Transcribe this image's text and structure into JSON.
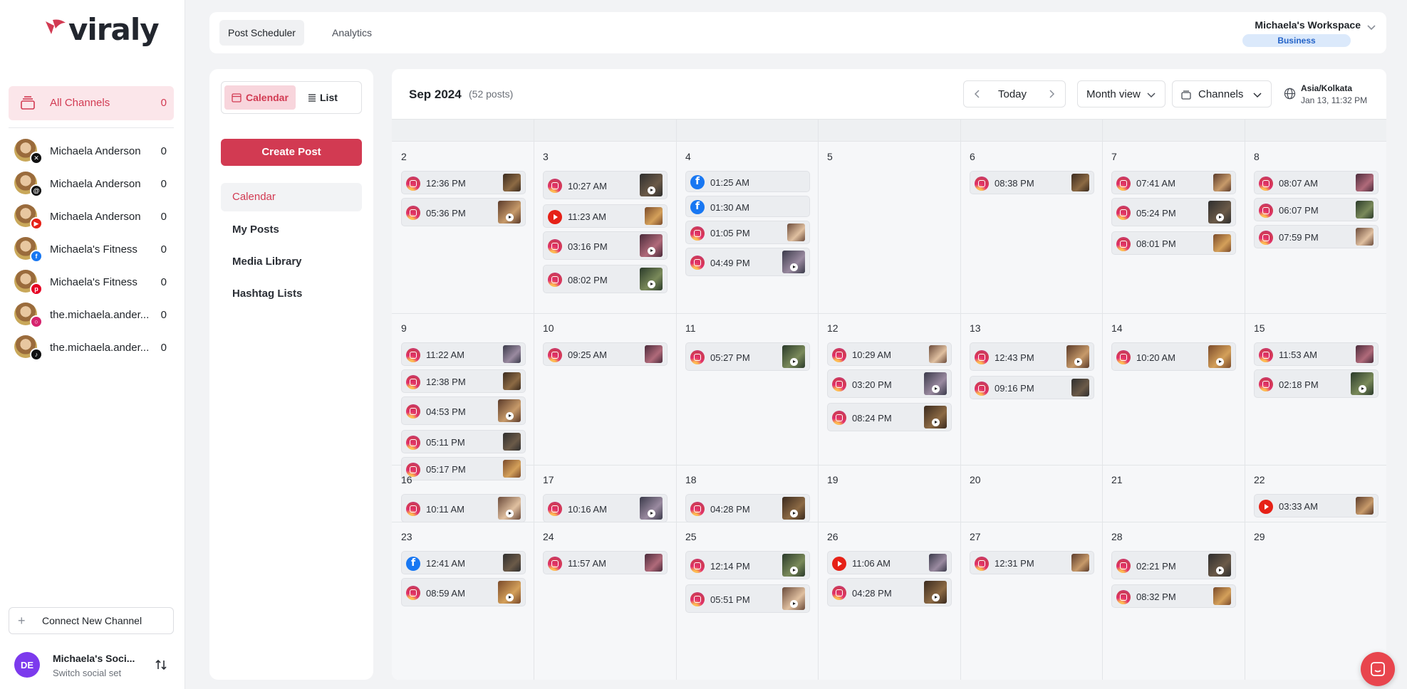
{
  "brand": {
    "name": "viraly"
  },
  "sidebar": {
    "all_channels": {
      "label": "All Channels",
      "count": "0"
    },
    "channels": [
      {
        "name": "Michaela Anderson",
        "count": "0",
        "platform": "x-icon"
      },
      {
        "name": "Michaela Anderson",
        "count": "0",
        "platform": "threads-icon"
      },
      {
        "name": "Michaela Anderson",
        "count": "0",
        "platform": "youtube-icon"
      },
      {
        "name": "Michaela's Fitness",
        "count": "0",
        "platform": "facebook-icon"
      },
      {
        "name": "Michaela's Fitness",
        "count": "0",
        "platform": "pinterest-icon"
      },
      {
        "name": "the.michaela.ander...",
        "count": "0",
        "platform": "instagram-icon"
      },
      {
        "name": "the.michaela.ander...",
        "count": "0",
        "platform": "tiktok-icon"
      }
    ],
    "connect_label": "Connect New Channel",
    "social_set": {
      "initials": "DE",
      "name": "Michaela's Soci...",
      "sub": "Switch social set"
    }
  },
  "topbar": {
    "tabs": [
      "Post Scheduler",
      "Analytics"
    ],
    "workspace": "Michaela's Workspace",
    "plan": "Business"
  },
  "nav": {
    "view_calendar": "Calendar",
    "view_list": "List",
    "create_post": "Create Post",
    "items": [
      "Calendar",
      "My Posts",
      "Media Library",
      "Hashtag Lists"
    ]
  },
  "calendar": {
    "month": "Sep 2024",
    "post_count": "(52 posts)",
    "today_label": "Today",
    "view_label": "Month view",
    "channels_label": "Channels",
    "timezone": "Asia/Kolkata",
    "now": "Jan 13, 11:32 PM",
    "weeks": [
      {
        "days": [
          {
            "num": "2",
            "posts": [
              {
                "t": "12:36 PM",
                "p": "ig",
                "v": false
              },
              {
                "t": "05:36 PM",
                "p": "ig",
                "v": true
              }
            ]
          },
          {
            "num": "3",
            "posts": [
              {
                "t": "10:27 AM",
                "p": "ig",
                "v": true
              },
              {
                "t": "11:23 AM",
                "p": "yt",
                "v": false
              },
              {
                "t": "03:16 PM",
                "p": "ig",
                "v": true
              },
              {
                "t": "08:02 PM",
                "p": "ig",
                "v": true
              }
            ]
          },
          {
            "num": "4",
            "posts": [
              {
                "t": "01:25 AM",
                "p": "fb",
                "n": true
              },
              {
                "t": "01:30 AM",
                "p": "fb",
                "n": true
              },
              {
                "t": "01:05 PM",
                "p": "ig",
                "v": false
              },
              {
                "t": "04:49 PM",
                "p": "ig",
                "v": true
              }
            ]
          },
          {
            "num": "5",
            "posts": []
          },
          {
            "num": "6",
            "posts": [
              {
                "t": "08:38 PM",
                "p": "ig",
                "v": false
              }
            ]
          },
          {
            "num": "7",
            "posts": [
              {
                "t": "07:41 AM",
                "p": "ig",
                "v": false
              },
              {
                "t": "05:24 PM",
                "p": "ig",
                "v": true
              },
              {
                "t": "08:01 PM",
                "p": "ig",
                "v": false
              }
            ]
          },
          {
            "num": "8",
            "posts": [
              {
                "t": "08:07 AM",
                "p": "ig",
                "v": false
              },
              {
                "t": "06:07 PM",
                "p": "ig",
                "v": false
              },
              {
                "t": "07:59 PM",
                "p": "ig",
                "v": false
              }
            ]
          }
        ]
      },
      {
        "days": [
          {
            "num": "9",
            "posts": [
              {
                "t": "11:22 AM",
                "p": "ig",
                "v": false
              },
              {
                "t": "12:38 PM",
                "p": "ig",
                "v": false
              },
              {
                "t": "04:53 PM",
                "p": "ig",
                "v": true
              },
              {
                "t": "05:11 PM",
                "p": "ig",
                "v": false
              },
              {
                "t": "05:17 PM",
                "p": "ig",
                "v": false
              }
            ]
          },
          {
            "num": "10",
            "posts": [
              {
                "t": "09:25 AM",
                "p": "ig",
                "v": false
              }
            ]
          },
          {
            "num": "11",
            "posts": [
              {
                "t": "05:27 PM",
                "p": "ig",
                "v": true
              }
            ]
          },
          {
            "num": "12",
            "posts": [
              {
                "t": "10:29 AM",
                "p": "ig",
                "v": false
              },
              {
                "t": "03:20 PM",
                "p": "ig",
                "v": true
              },
              {
                "t": "08:24 PM",
                "p": "ig",
                "v": true
              }
            ]
          },
          {
            "num": "13",
            "posts": [
              {
                "t": "12:43 PM",
                "p": "ig",
                "v": true
              },
              {
                "t": "09:16 PM",
                "p": "ig",
                "v": false
              }
            ]
          },
          {
            "num": "14",
            "posts": [
              {
                "t": "10:20 AM",
                "p": "ig",
                "v": true
              }
            ]
          },
          {
            "num": "15",
            "posts": [
              {
                "t": "11:53 AM",
                "p": "ig",
                "v": false
              },
              {
                "t": "02:18 PM",
                "p": "ig",
                "v": true
              }
            ]
          }
        ]
      },
      {
        "days": [
          {
            "num": "16",
            "posts": [
              {
                "t": "10:11 AM",
                "p": "ig",
                "v": true
              }
            ]
          },
          {
            "num": "17",
            "posts": [
              {
                "t": "10:16 AM",
                "p": "ig",
                "v": true
              }
            ]
          },
          {
            "num": "18",
            "posts": [
              {
                "t": "04:28 PM",
                "p": "ig",
                "v": true
              }
            ]
          },
          {
            "num": "19",
            "posts": []
          },
          {
            "num": "20",
            "posts": []
          },
          {
            "num": "21",
            "posts": []
          },
          {
            "num": "22",
            "posts": [
              {
                "t": "03:33 AM",
                "p": "yt",
                "v": false
              }
            ]
          }
        ]
      },
      {
        "days": [
          {
            "num": "23",
            "posts": [
              {
                "t": "12:41 AM",
                "p": "fb",
                "v": false
              },
              {
                "t": "08:59 AM",
                "p": "ig",
                "v": true
              }
            ]
          },
          {
            "num": "24",
            "posts": [
              {
                "t": "11:57 AM",
                "p": "ig",
                "v": false
              }
            ]
          },
          {
            "num": "25",
            "posts": [
              {
                "t": "12:14 PM",
                "p": "ig",
                "v": true
              },
              {
                "t": "05:51 PM",
                "p": "ig",
                "v": true
              }
            ]
          },
          {
            "num": "26",
            "posts": [
              {
                "t": "11:06 AM",
                "p": "yt",
                "v": false
              },
              {
                "t": "04:28 PM",
                "p": "ig",
                "v": true
              }
            ]
          },
          {
            "num": "27",
            "posts": [
              {
                "t": "12:31 PM",
                "p": "ig",
                "v": false
              }
            ]
          },
          {
            "num": "28",
            "posts": [
              {
                "t": "02:21 PM",
                "p": "ig",
                "v": true
              },
              {
                "t": "08:32 PM",
                "p": "ig",
                "v": false
              }
            ]
          },
          {
            "num": "29",
            "posts": []
          }
        ]
      }
    ]
  },
  "colors": {
    "accent": "#d23a52",
    "accent_soft": "#fbe6ea",
    "plan_bg": "#dbe9fb",
    "plan_text": "#2463c8"
  }
}
